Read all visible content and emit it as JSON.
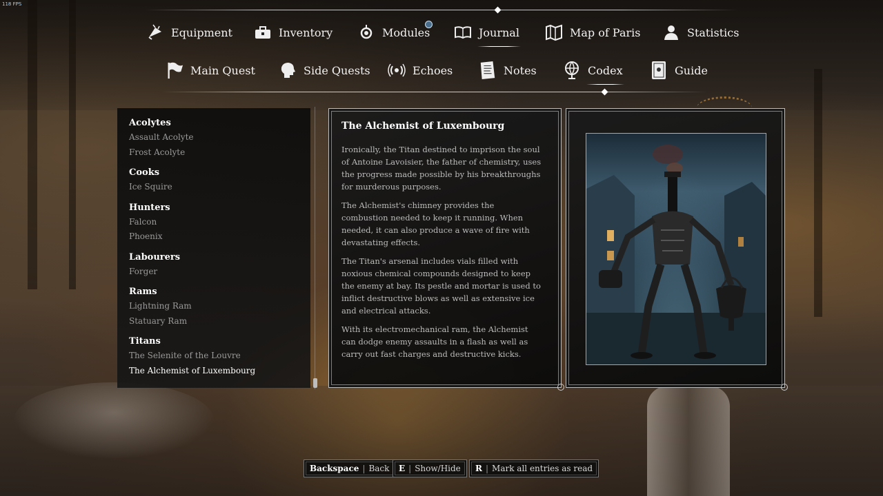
{
  "fps_counter": "118 FPS",
  "main_tabs": [
    {
      "label": "Equipment",
      "icon": "fan-icon"
    },
    {
      "label": "Inventory",
      "icon": "toolbox-icon"
    },
    {
      "label": "Modules",
      "icon": "module-icon"
    },
    {
      "label": "Journal",
      "icon": "open-book-icon",
      "active": true
    },
    {
      "label": "Map of Paris",
      "icon": "folded-map-icon"
    },
    {
      "label": "Statistics",
      "icon": "person-icon"
    }
  ],
  "sub_tabs": [
    {
      "label": "Main Quest",
      "icon": "flag-icon"
    },
    {
      "label": "Side Quests",
      "icon": "head-profile-icon"
    },
    {
      "label": "Echoes",
      "icon": "signal-icon"
    },
    {
      "label": "Notes",
      "icon": "note-icon"
    },
    {
      "label": "Codex",
      "icon": "globe-icon",
      "active": true
    },
    {
      "label": "Guide",
      "icon": "guide-book-icon"
    }
  ],
  "codex_list": [
    {
      "category": "Acolytes",
      "entries": [
        "Assault Acolyte",
        "Frost Acolyte"
      ]
    },
    {
      "category": "Cooks",
      "entries": [
        "Ice Squire"
      ]
    },
    {
      "category": "Hunters",
      "entries": [
        "Falcon",
        "Phoenix"
      ]
    },
    {
      "category": "Labourers",
      "entries": [
        "Forger"
      ]
    },
    {
      "category": "Rams",
      "entries": [
        "Lightning Ram",
        "Statuary Ram"
      ]
    },
    {
      "category": "Titans",
      "entries": [
        "The Selenite of the Louvre",
        "The Alchemist of Luxembourg"
      ]
    }
  ],
  "selected_entry": "The Alchemist of Luxembourg",
  "entry": {
    "title": "The Alchemist of Luxembourg",
    "paragraphs": [
      "Ironically, the Titan destined to imprison the soul of Antoine Lavoisier, the father of chemistry, uses the progress made possible by his breakthroughs for murderous purposes.",
      "The Alchemist's chimney provides the combustion needed to keep it running. When needed, it can also produce a wave of fire with devastating effects.",
      "The Titan's arsenal includes vials filled with noxious chemical compounds designed to keep the enemy at bay. Its pestle and mortar is used to inflict destructive blows as well as extensive ice and electrical attacks.",
      "With its electromechanical ram, the Alchemist can dodge enemy assaults in a flash as well as carry out fast charges and destructive kicks."
    ]
  },
  "hints": [
    {
      "key": "Backspace",
      "action": "Back"
    },
    {
      "key": "E",
      "action": "Show/Hide"
    },
    {
      "key": "R",
      "action": "Mark all entries as read"
    }
  ],
  "colors": {
    "panel_bg": "#0c0c0c",
    "text_primary": "#ffffff",
    "text_secondary": "#9a9a9a",
    "notification": "#4a6d8c"
  }
}
